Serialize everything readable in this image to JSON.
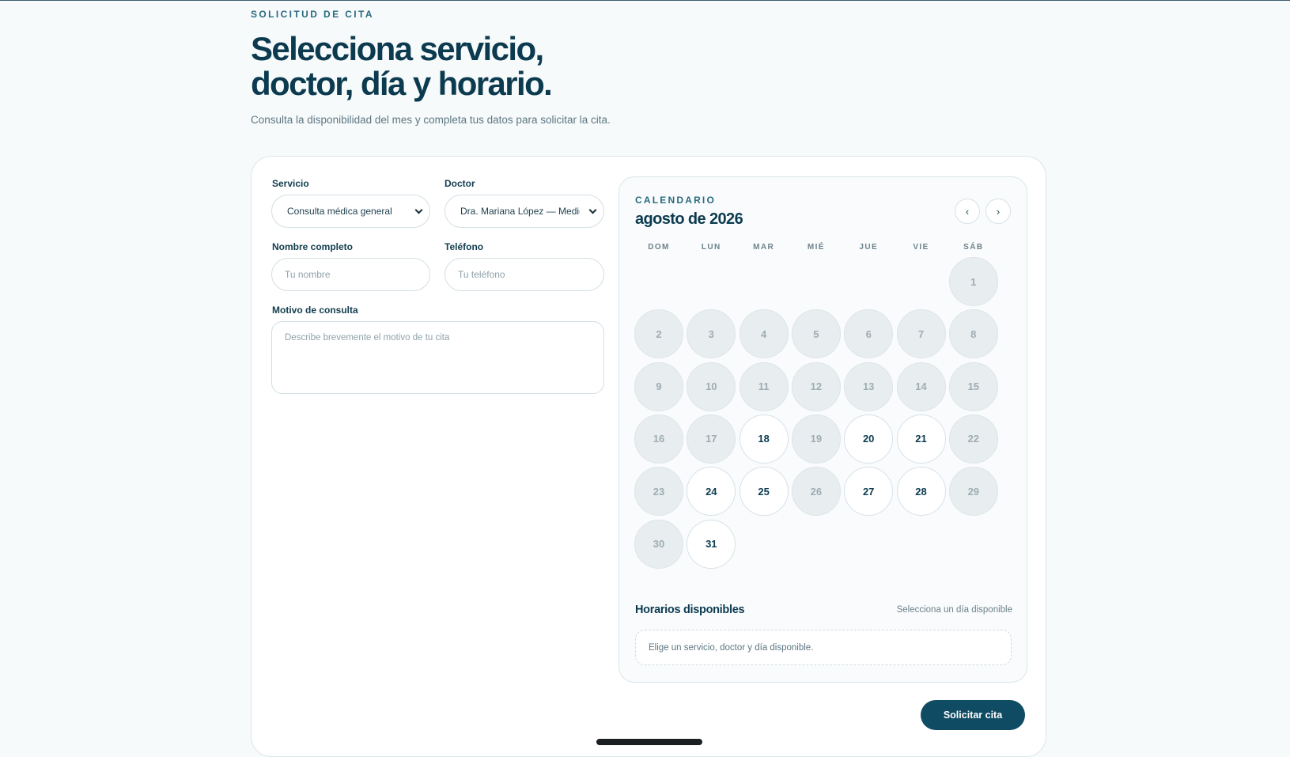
{
  "header": {
    "eyebrow": "SOLICITUD DE CITA",
    "title_line1": "Selecciona servicio,",
    "title_line2": "doctor, día y horario.",
    "subtitle": "Consulta la disponibilidad del mes y completa tus datos para solicitar la cita."
  },
  "form": {
    "service_label": "Servicio",
    "service_value": "Consulta médica general",
    "doctor_label": "Doctor",
    "doctor_value": "Dra. Mariana López — Medicina General",
    "name_label": "Nombre completo",
    "name_placeholder": "Tu nombre",
    "phone_label": "Teléfono",
    "phone_placeholder": "Tu teléfono",
    "reason_label": "Motivo de consulta",
    "reason_placeholder": "Describe brevemente el motivo de tu cita"
  },
  "calendar": {
    "eyebrow": "CALENDARIO",
    "month": "agosto de 2026",
    "prev_icon": "‹",
    "next_icon": "›",
    "weekdays": [
      "DOM",
      "LUN",
      "MAR",
      "MIÉ",
      "JUE",
      "VIE",
      "SÁB"
    ],
    "first_weekday": 6,
    "days_in_month": 31,
    "available_days": [
      18,
      20,
      21,
      24,
      25,
      27,
      28,
      31
    ]
  },
  "slots": {
    "title": "Horarios disponibles",
    "hint": "Selecciona un día disponible",
    "empty_message": "Elige un servicio, doctor y día disponible."
  },
  "actions": {
    "submit_label": "Solicitar cita"
  },
  "colors": {
    "primary": "#0f4b63",
    "text": "#0c3b50",
    "unavailable_day": "#e8edef"
  }
}
